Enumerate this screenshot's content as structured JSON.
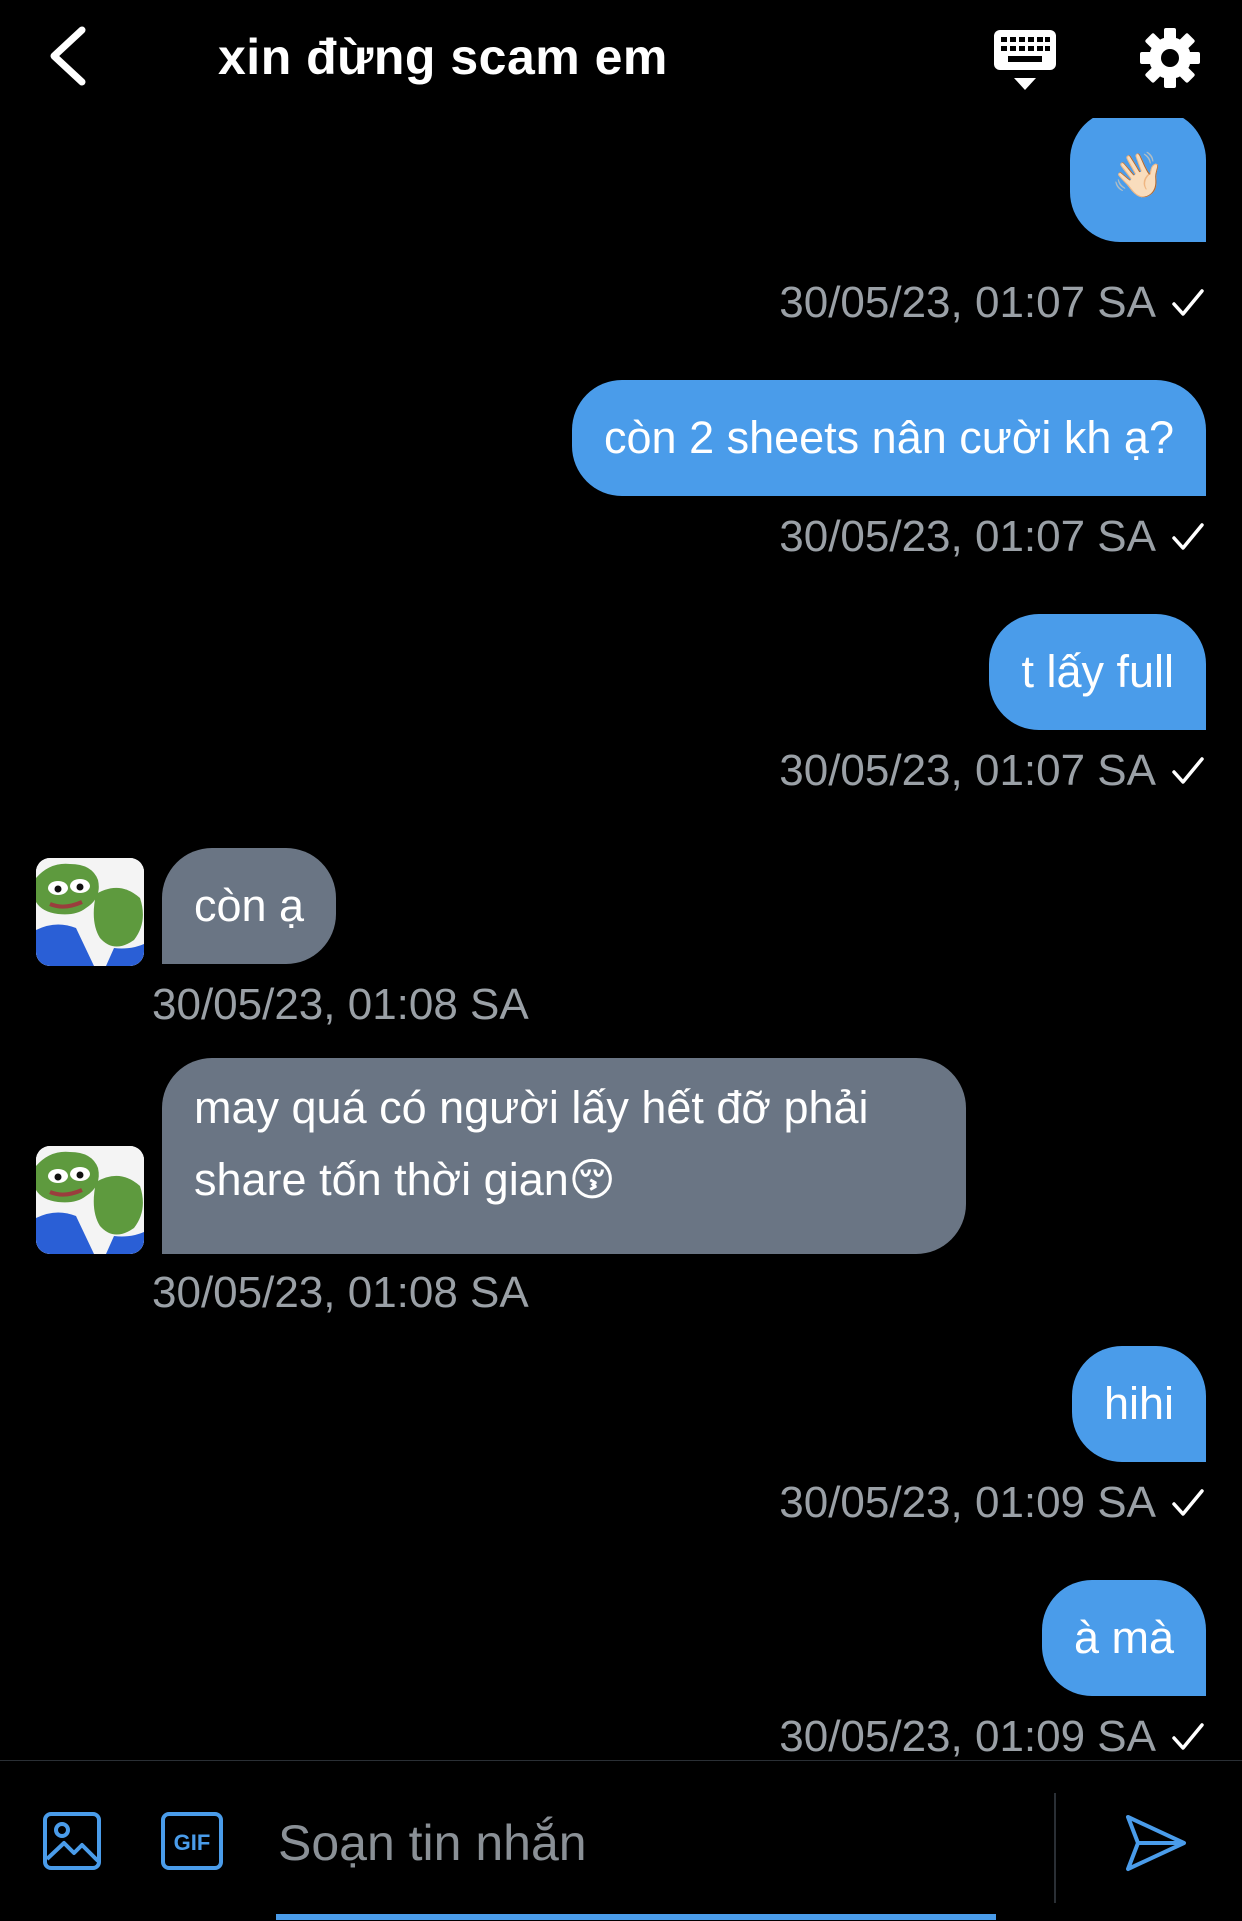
{
  "header": {
    "title": "xin đừng scam em"
  },
  "messages": [
    {
      "side": "out",
      "text": "👋🏻",
      "time": "30/05/23, 01:07 SA"
    },
    {
      "side": "out",
      "text": "còn 2 sheets nân cười kh ạ?",
      "time": "30/05/23, 01:07 SA"
    },
    {
      "side": "out",
      "text": "t lấy full",
      "time": "30/05/23, 01:07 SA"
    },
    {
      "side": "in",
      "text": "còn ạ",
      "time": "30/05/23, 01:08 SA"
    },
    {
      "side": "in",
      "text_line1": "may quá có người lấy hết đỡ phải",
      "text_line2": "share tốn thời gian😚",
      "time": "30/05/23, 01:08 SA"
    },
    {
      "side": "out",
      "text": "hihi",
      "time": "30/05/23, 01:09 SA"
    },
    {
      "side": "out",
      "text": "à mà",
      "time": "30/05/23, 01:09 SA"
    }
  ],
  "composer": {
    "placeholder": "Soạn tin nhắn",
    "value": ""
  },
  "icons": {
    "back": "chevron-left-icon",
    "keyboard": "keyboard-icon",
    "settings": "gear-icon",
    "image": "image-icon",
    "gif": "gif-icon",
    "send": "send-icon",
    "read": "check-icon"
  },
  "colors": {
    "accent": "#4a9cea",
    "incoming_bubble": "#6a7584",
    "timestamp": "#9aa0a6",
    "background": "#000000"
  }
}
